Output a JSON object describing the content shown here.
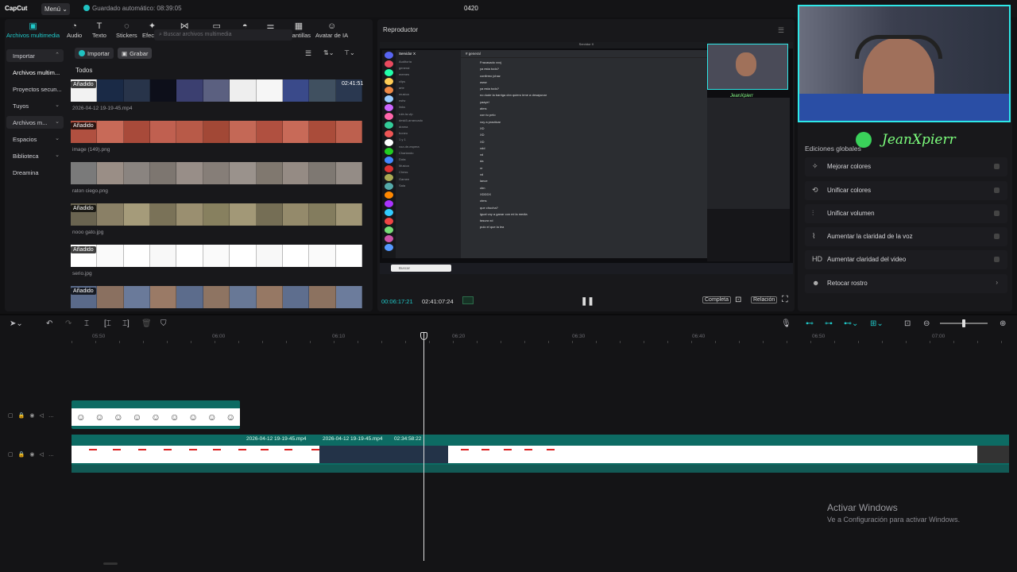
{
  "app": {
    "logo": "CapCut",
    "menu": "Menú ⌄",
    "autosave": "Guardado automático: 08:39:05",
    "project": "0420"
  },
  "toolbar": [
    {
      "label": "Archivos multimedia",
      "icon": "media-icon",
      "glyph": "▣"
    },
    {
      "label": "Audio",
      "icon": "audio-icon",
      "glyph": "◔"
    },
    {
      "label": "Texto",
      "icon": "text-icon",
      "glyph": "T"
    },
    {
      "label": "Stickers",
      "icon": "sticker-icon",
      "glyph": "◌"
    },
    {
      "label": "Efectos",
      "icon": "effects-icon",
      "glyph": "✦"
    },
    {
      "label": "Transiciones",
      "icon": "transition-icon",
      "glyph": "⋈"
    },
    {
      "label": "Subtítulos",
      "icon": "subtitle-icon",
      "glyph": "▭"
    },
    {
      "label": "Filtros",
      "icon": "filter-icon",
      "glyph": "◓"
    },
    {
      "label": "Ajuste",
      "icon": "adjust-icon",
      "glyph": "⚌"
    },
    {
      "label": "Plantillas",
      "icon": "template-icon",
      "glyph": "▦"
    },
    {
      "label": "Avatar de IA",
      "icon": "avatar-icon",
      "glyph": "☺"
    }
  ],
  "sidebar": [
    {
      "label": "Importar",
      "chev": "⌃"
    },
    {
      "label": "Archivos multim...",
      "chev": ""
    },
    {
      "label": "Proyectos secun...",
      "chev": ""
    },
    {
      "label": "Tuyos",
      "chev": "⌄"
    },
    {
      "label": "Archivos m...",
      "chev": "⌄"
    },
    {
      "label": "Espacios",
      "chev": "⌄"
    },
    {
      "label": "Biblioteca",
      "chev": "⌄"
    },
    {
      "label": "Dreamina",
      "chev": ""
    }
  ],
  "media": {
    "import": "Importar",
    "record": "Grabar",
    "search_placeholder": "Buscar archivos multimedia",
    "all": "Todos",
    "items": [
      {
        "badge": "Añadido",
        "name": "2026-04-12 19-19-45.mp4",
        "duration": "02:41:51"
      },
      {
        "badge": "Añadido",
        "name": "image (149).png"
      },
      {
        "badge": "",
        "name": "raton ciego.png"
      },
      {
        "badge": "Añadido",
        "name": "nooo gato.jpg"
      },
      {
        "badge": "Añadido",
        "name": "serio.jpg"
      },
      {
        "badge": "Añadido",
        "name": ""
      }
    ]
  },
  "player": {
    "title": "Reproductor",
    "current": "00:06:17:21",
    "total": "02:41:07:24",
    "full": "Completa",
    "ratio": "Relación",
    "discord": {
      "server": "Servidor X",
      "channel": "general",
      "channels": [
        "Auditoría",
        "general",
        "memes",
        "clips",
        "arte",
        "musica",
        "nsfw",
        "links",
        "rule-la-vip",
        "desk5-arrancado",
        "drama",
        "boneo",
        "1 y 1",
        "voz-de-espera",
        "Charlando",
        "Dota",
        "Musica",
        "Chess",
        "Gamee",
        "Sala"
      ],
      "messages": [
        "Fracasado xxxj",
        "ya esta todo?",
        "confirmo jchaz",
        "www",
        "ya esta todo?",
        "no dude la barriga cbn quiero irme a desayunar",
        "yaaye!",
        "alms",
        "con tu pelo",
        "voy a practicar",
        "XD",
        "XD",
        "XD",
        "xdd",
        "xd",
        "da",
        "xr",
        "xd",
        "lance",
        "cbn",
        "XDDDX",
        "ctms",
        "que chucha?",
        "igual voy a ganar con mi la media",
        "tasura xd",
        "pulo el que la lea"
      ],
      "taskbar_search": "Buscar"
    }
  },
  "stream": {
    "name": "JeanXpierr",
    "overlay_name": "JeanXpierr"
  },
  "edits": {
    "title": "Ediciones globales",
    "items": [
      {
        "icon": "enhance-color-icon",
        "glyph": "✧",
        "label": "Mejorar colores"
      },
      {
        "icon": "unify-color-icon",
        "glyph": "⟲",
        "label": "Unificar colores"
      },
      {
        "icon": "unify-volume-icon",
        "glyph": "⫶",
        "label": "Unificar volumen"
      },
      {
        "icon": "voice-clarity-icon",
        "glyph": "⌇",
        "label": "Aumentar la claridad de la voz"
      },
      {
        "icon": "hd-icon",
        "glyph": "HD",
        "label": "Aumentar claridad del video"
      },
      {
        "icon": "retouch-face-icon",
        "glyph": "☻",
        "label": "Retocar rostro"
      }
    ]
  },
  "timeline": {
    "ruler": [
      "05:50",
      "06:00",
      "06:10",
      "06:20",
      "06:30",
      "06:40",
      "06:50",
      "07:00"
    ],
    "clip_labels": [
      "2026-04-12 19-19-45.mp4",
      "2026-04-12 19-19-45.mp4",
      "02:34:58:22"
    ]
  },
  "watermark": {
    "title": "Activar Windows",
    "subtitle": "Ve a Configuración para activar Windows."
  }
}
